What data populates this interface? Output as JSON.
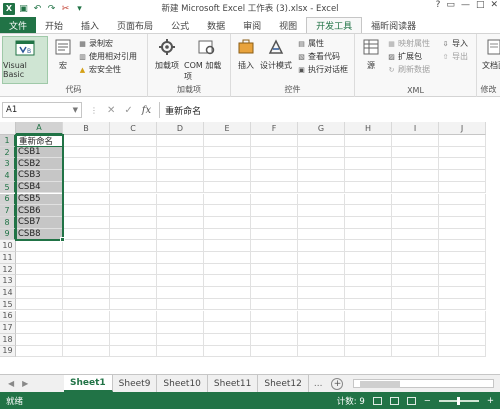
{
  "window": {
    "title": "新建 Microsoft Excel 工作表 (3).xlsx - Excel",
    "logo_letter": "X",
    "controls": [
      "?",
      "▭",
      "—",
      "□",
      "✕"
    ]
  },
  "ribbon_tabs": [
    {
      "label": "文件",
      "kind": "file"
    },
    {
      "label": "开始"
    },
    {
      "label": "插入"
    },
    {
      "label": "页面布局"
    },
    {
      "label": "公式"
    },
    {
      "label": "数据"
    },
    {
      "label": "审阅"
    },
    {
      "label": "视图"
    },
    {
      "label": "开发工具",
      "active": true
    },
    {
      "label": "福昕阅读器"
    }
  ],
  "ribbon": {
    "code": {
      "label": "代码",
      "visual_basic": "Visual Basic",
      "macros": "宏",
      "record_macro": "录制宏",
      "relative_ref": "使用相对引用",
      "macro_security": "宏安全性"
    },
    "addins": {
      "label": "加载项",
      "addins": "加载项",
      "com_addins": "COM 加载项"
    },
    "controls": {
      "label": "控件",
      "insert": "插入",
      "design_mode": "设计模式",
      "properties": "属性",
      "view_code": "查看代码",
      "run_dialog": "执行对话框"
    },
    "xml": {
      "label": "XML",
      "source": "源",
      "map_properties": "映射属性",
      "expansion_packs": "扩展包",
      "refresh_data": "刷新数据",
      "import": "导入",
      "export": "导出"
    },
    "modify": {
      "label": "修改",
      "doc_panel": "文档面"
    }
  },
  "formula_bar": {
    "name_box": "A1",
    "cancel": "✕",
    "enter": "✓",
    "fx": "fx",
    "content": "重新命名"
  },
  "columns": [
    "A",
    "B",
    "C",
    "D",
    "E",
    "F",
    "G",
    "H",
    "I",
    "J"
  ],
  "rows": [
    "1",
    "2",
    "3",
    "4",
    "5",
    "6",
    "7",
    "8",
    "9",
    "10",
    "11",
    "12",
    "13",
    "14",
    "15",
    "16",
    "17",
    "18",
    "19"
  ],
  "cells": {
    "A1": "重新命名",
    "A2": "CSB1",
    "A3": "CSB2",
    "A4": "CSB3",
    "A5": "CSB4",
    "A6": "CSB5",
    "A7": "CSB6",
    "A8": "CSB7",
    "A9": "CSB8"
  },
  "selection": "A1:A9",
  "sheets": [
    {
      "label": "Sheet1",
      "active": true
    },
    {
      "label": "Sheet9"
    },
    {
      "label": "Sheet10"
    },
    {
      "label": "Sheet11"
    },
    {
      "label": "Sheet12"
    }
  ],
  "sheet_more": "...",
  "add_sheet": "+",
  "status": {
    "left": "就绪",
    "count": "计数: 9"
  },
  "colors": {
    "accent": "#217346",
    "selection_fill": "#c6c6c6"
  }
}
